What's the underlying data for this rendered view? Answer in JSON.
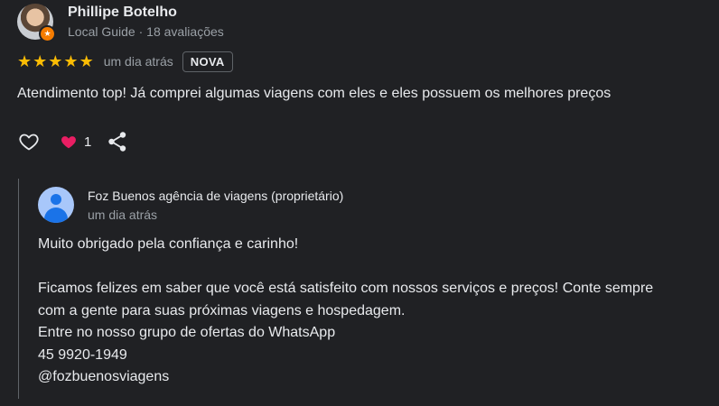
{
  "review": {
    "author_name": "Phillipe Botelho",
    "author_meta": "Local Guide · 18 avaliações",
    "rating": 5,
    "date": "um dia atrás",
    "badge": "NOVA",
    "text": "Atendimento top! Já comprei algumas viagens com eles e eles possuem os melhores preços",
    "like_count": "1",
    "colors": {
      "star": "#fbbc04",
      "heart": "#e91e63",
      "guide_badge": "#f57c00"
    }
  },
  "owner_reply": {
    "owner_name": "Foz Buenos agência de viagens (proprietário)",
    "date": "um dia atrás",
    "lines": [
      "Muito obrigado pela confiança e carinho!",
      "",
      "Ficamos felizes em saber que você está satisfeito com nossos serviços e preços! Conte sempre",
      "com a gente para suas próximas viagens e hospedagem.",
      "Entre no nosso grupo de ofertas do WhatsApp",
      "45 9920-1949",
      "@fozbuenosviagens"
    ]
  },
  "icons": {
    "like": "heart-outline-icon",
    "reaction": "heart-filled-icon",
    "share": "share-icon",
    "guide": "local-guide-badge-icon"
  }
}
